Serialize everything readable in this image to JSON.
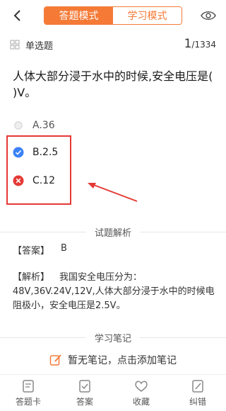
{
  "header": {
    "mode_quiz": "答题模式",
    "mode_study": "学习模式",
    "active_mode": "答题模式",
    "accent_color": "#f47a36"
  },
  "question_meta": {
    "type_label": "单选题",
    "current": "1",
    "total": "/1334"
  },
  "question": {
    "text": "人体大部分浸于水中的时候,安全电压是(   )V。"
  },
  "options": [
    {
      "label": "A.36",
      "state": "unselected"
    },
    {
      "label": "B.2.5",
      "state": "correct"
    },
    {
      "label": "C.12",
      "state": "wrong"
    }
  ],
  "analysis": {
    "section_title": "试题解析",
    "answer_key": "【答案】",
    "answer_value": "B",
    "explain_key": "【解析】",
    "explain_text": "我国安全电压分为：48V,36V.24V,12V,人体大部分浸于水中的时候电阻极小，安全电压是2.5V。"
  },
  "notes": {
    "section_title": "学习笔记",
    "empty_text": "暂无笔记，点击添加笔记"
  },
  "bottom_bar": {
    "items": [
      {
        "label": "答题卡",
        "icon": "answer-sheet-icon"
      },
      {
        "label": "答案",
        "icon": "answer-icon"
      },
      {
        "label": "收藏",
        "icon": "heart-icon"
      },
      {
        "label": "纠错",
        "icon": "report-error-icon"
      }
    ]
  },
  "colors": {
    "correct": "#3b82f6",
    "wrong": "#e53935",
    "annotation_red": "#e53935"
  }
}
